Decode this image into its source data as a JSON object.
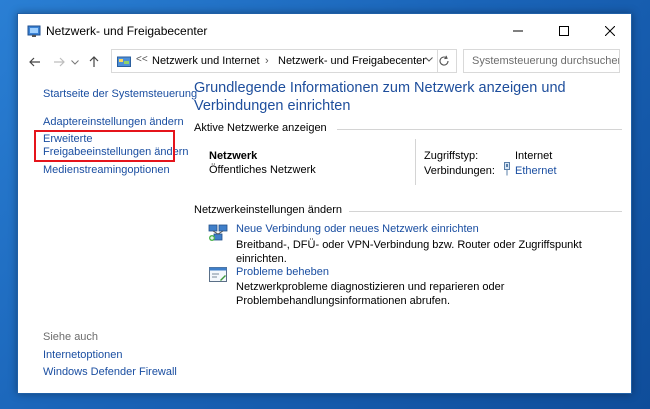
{
  "window": {
    "title": "Netzwerk- und Freigabecenter"
  },
  "addressbar": {
    "overflow_chevron": "<<",
    "breadcrumbs": [
      "Netzwerk und Internet",
      "Netzwerk- und Freigabecenter"
    ],
    "search_placeholder": "Systemsteuerung durchsuchen"
  },
  "sidebar": {
    "home_link": "Startseite der Systemsteuerung",
    "links": [
      "Adaptereinstellungen ändern",
      "Erweiterte",
      "Freigabeeinstellungen ändern",
      "Medienstreamingoptionen"
    ],
    "see_also_heading": "Siehe auch",
    "see_also_links": [
      "Internetoptionen",
      "Windows Defender Firewall"
    ]
  },
  "main": {
    "title": "Grundlegende Informationen zum Netzwerk anzeigen und Verbindungen einrichten",
    "active_networks_heading": "Aktive Netzwerke anzeigen",
    "network": {
      "name": "Netzwerk",
      "type": "Öffentliches Netzwerk",
      "access_type_label": "Zugriffstyp:",
      "access_type_value": "Internet",
      "connections_label": "Verbindungen:",
      "connection_link": "Ethernet"
    },
    "settings_heading": "Netzwerkeinstellungen ändern",
    "tasks": [
      {
        "link": "Neue Verbindung oder neues Netzwerk einrichten",
        "description": "Breitband-, DFÜ- oder VPN-Verbindung bzw. Router oder Zugriffspunkt einrichten."
      },
      {
        "link": "Probleme beheben",
        "description": "Netzwerkprobleme diagnostizieren und reparieren oder Problembehandlungsinformationen abrufen."
      }
    ]
  },
  "colors": {
    "link": "#1a4ea1",
    "title": "#1e4e9c",
    "highlight": "#e5141b",
    "desktop": "#1a64b8"
  },
  "icons": {
    "app": "network-center-icon",
    "back": "arrow-left-icon",
    "forward": "arrow-right-icon",
    "recent": "chevron-down-icon",
    "up": "arrow-up-icon",
    "refresh": "refresh-icon",
    "search": "search-icon"
  }
}
